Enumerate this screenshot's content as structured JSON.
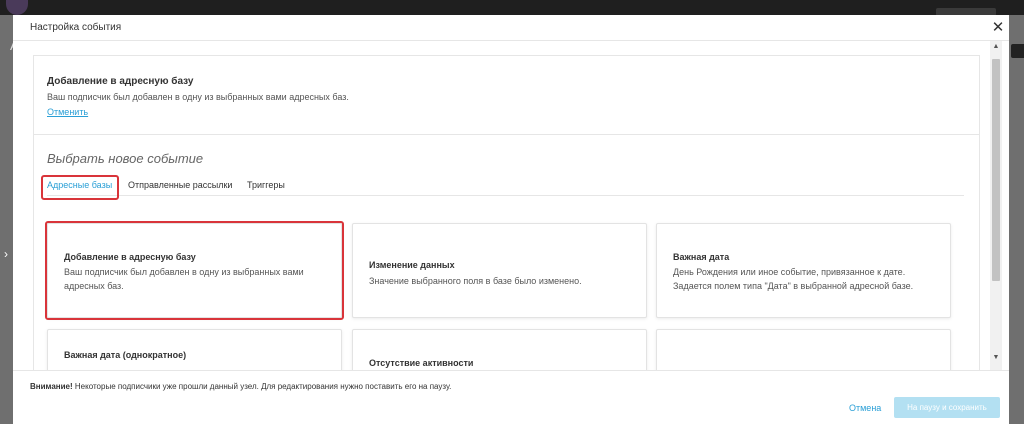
{
  "modal": {
    "title": "Настройка события",
    "close_icon": "close-icon"
  },
  "current_event": {
    "title": "Добавление в адресную базу",
    "description": "Ваш подписчик был добавлен в одну из выбранных вами адресных баз.",
    "cancel_label": "Отменить"
  },
  "section_title": "Выбрать новое событие",
  "tabs": [
    {
      "label": "Адресные базы",
      "active": true
    },
    {
      "label": "Отправленные рассылки",
      "active": false
    },
    {
      "label": "Триггеры",
      "active": false
    }
  ],
  "cards": [
    {
      "title": "Добавление в адресную базу",
      "description": "Ваш подписчик был добавлен в одну из выбранных вами адресных баз.",
      "highlighted": true
    },
    {
      "title": "Изменение данных",
      "description": "Значение выбранного поля в базе было изменено."
    },
    {
      "title": "Важная дата",
      "description": "День Рождения или иное событие, привязанное к дате. Задается полем типа \"Дата\" в выбранной адресной базе."
    },
    {
      "title": "Важная дата (однократное)",
      "description": ""
    },
    {
      "title": "Отсутствие активности",
      "description": ""
    },
    {
      "title": "",
      "description": ""
    }
  ],
  "footer": {
    "warning_bold": "Внимание!",
    "warning_text": " Некоторые подписчики уже прошли данный узел. Для редактирования нужно поставить его на паузу.",
    "cancel_label": "Отмена",
    "save_label": "На паузу и сохранить"
  },
  "colors": {
    "accent": "#2a9fd6",
    "highlight": "#d9343a",
    "disabled_button": "#b3e0f2"
  }
}
